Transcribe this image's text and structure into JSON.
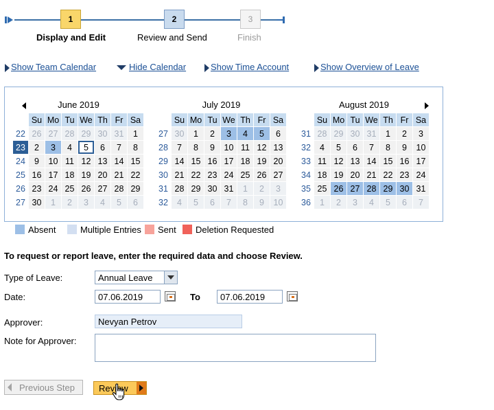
{
  "roadmap": {
    "steps": [
      {
        "number": "1",
        "label": "Display and Edit",
        "state": "current"
      },
      {
        "number": "2",
        "label": "Review and Send",
        "state": "upcoming"
      },
      {
        "number": "3",
        "label": "Finish",
        "state": "disabled"
      }
    ]
  },
  "links": {
    "show_team_calendar": "Show Team Calendar",
    "hide_calendar": "Hide Calendar",
    "show_time_account": "Show Time Account",
    "show_overview_of_leave": "Show Overview of Leave"
  },
  "calendar": {
    "weekday_headers": [
      "Su",
      "Mo",
      "Tu",
      "We",
      "Th",
      "Fr",
      "Sa"
    ],
    "months": [
      {
        "title": "June 2019",
        "weeks": [
          {
            "num": "22",
            "days": [
              [
                "26",
                "other"
              ],
              [
                "27",
                "other"
              ],
              [
                "28",
                "other"
              ],
              [
                "29",
                "other"
              ],
              [
                "30",
                "other"
              ],
              [
                "31",
                "other"
              ],
              [
                "1",
                ""
              ]
            ]
          },
          {
            "num": "23",
            "selected": true,
            "days": [
              [
                "2",
                ""
              ],
              [
                "3",
                "absent"
              ],
              [
                "4",
                ""
              ],
              [
                "5",
                "today"
              ],
              [
                "6",
                ""
              ],
              [
                "7",
                ""
              ],
              [
                "8",
                ""
              ]
            ]
          },
          {
            "num": "24",
            "days": [
              [
                "9",
                ""
              ],
              [
                "10",
                ""
              ],
              [
                "11",
                ""
              ],
              [
                "12",
                ""
              ],
              [
                "13",
                ""
              ],
              [
                "14",
                ""
              ],
              [
                "15",
                ""
              ]
            ]
          },
          {
            "num": "25",
            "days": [
              [
                "16",
                ""
              ],
              [
                "17",
                ""
              ],
              [
                "18",
                ""
              ],
              [
                "19",
                ""
              ],
              [
                "20",
                ""
              ],
              [
                "21",
                ""
              ],
              [
                "22",
                ""
              ]
            ]
          },
          {
            "num": "26",
            "days": [
              [
                "23",
                ""
              ],
              [
                "24",
                ""
              ],
              [
                "25",
                ""
              ],
              [
                "26",
                ""
              ],
              [
                "27",
                ""
              ],
              [
                "28",
                ""
              ],
              [
                "29",
                ""
              ]
            ]
          },
          {
            "num": "27",
            "days": [
              [
                "30",
                ""
              ],
              [
                "1",
                "other"
              ],
              [
                "2",
                "other"
              ],
              [
                "3",
                "other"
              ],
              [
                "4",
                "other"
              ],
              [
                "5",
                "other"
              ],
              [
                "6",
                "other"
              ]
            ]
          }
        ]
      },
      {
        "title": "July 2019",
        "weeks": [
          {
            "num": "27",
            "days": [
              [
                "30",
                "other"
              ],
              [
                "1",
                ""
              ],
              [
                "2",
                ""
              ],
              [
                "3",
                "absent"
              ],
              [
                "4",
                "absent"
              ],
              [
                "5",
                "absent"
              ],
              [
                "6",
                ""
              ]
            ]
          },
          {
            "num": "28",
            "days": [
              [
                "7",
                ""
              ],
              [
                "8",
                ""
              ],
              [
                "9",
                ""
              ],
              [
                "10",
                ""
              ],
              [
                "11",
                ""
              ],
              [
                "12",
                ""
              ],
              [
                "13",
                ""
              ]
            ]
          },
          {
            "num": "29",
            "days": [
              [
                "14",
                ""
              ],
              [
                "15",
                ""
              ],
              [
                "16",
                ""
              ],
              [
                "17",
                ""
              ],
              [
                "18",
                ""
              ],
              [
                "19",
                ""
              ],
              [
                "20",
                ""
              ]
            ]
          },
          {
            "num": "30",
            "days": [
              [
                "21",
                ""
              ],
              [
                "22",
                ""
              ],
              [
                "23",
                ""
              ],
              [
                "24",
                ""
              ],
              [
                "25",
                ""
              ],
              [
                "26",
                ""
              ],
              [
                "27",
                ""
              ]
            ]
          },
          {
            "num": "31",
            "days": [
              [
                "28",
                ""
              ],
              [
                "29",
                ""
              ],
              [
                "30",
                ""
              ],
              [
                "31",
                ""
              ],
              [
                "1",
                "other"
              ],
              [
                "2",
                "other"
              ],
              [
                "3",
                "other"
              ]
            ]
          },
          {
            "num": "32",
            "days": [
              [
                "4",
                "other"
              ],
              [
                "5",
                "other"
              ],
              [
                "6",
                "other"
              ],
              [
                "7",
                "other"
              ],
              [
                "8",
                "other"
              ],
              [
                "9",
                "other"
              ],
              [
                "10",
                "other"
              ]
            ]
          }
        ]
      },
      {
        "title": "August 2019",
        "weeks": [
          {
            "num": "31",
            "days": [
              [
                "28",
                "other"
              ],
              [
                "29",
                "other"
              ],
              [
                "30",
                "other"
              ],
              [
                "31",
                "other"
              ],
              [
                "1",
                ""
              ],
              [
                "2",
                ""
              ],
              [
                "3",
                ""
              ]
            ]
          },
          {
            "num": "32",
            "days": [
              [
                "4",
                ""
              ],
              [
                "5",
                ""
              ],
              [
                "6",
                ""
              ],
              [
                "7",
                ""
              ],
              [
                "8",
                ""
              ],
              [
                "9",
                ""
              ],
              [
                "10",
                ""
              ]
            ]
          },
          {
            "num": "33",
            "days": [
              [
                "11",
                ""
              ],
              [
                "12",
                ""
              ],
              [
                "13",
                ""
              ],
              [
                "14",
                ""
              ],
              [
                "15",
                ""
              ],
              [
                "16",
                ""
              ],
              [
                "17",
                ""
              ]
            ]
          },
          {
            "num": "34",
            "days": [
              [
                "18",
                ""
              ],
              [
                "19",
                ""
              ],
              [
                "20",
                ""
              ],
              [
                "21",
                ""
              ],
              [
                "22",
                ""
              ],
              [
                "23",
                ""
              ],
              [
                "24",
                ""
              ]
            ]
          },
          {
            "num": "35",
            "days": [
              [
                "25",
                ""
              ],
              [
                "26",
                "absent"
              ],
              [
                "27",
                "absent"
              ],
              [
                "28",
                "absent"
              ],
              [
                "29",
                "absent"
              ],
              [
                "30",
                "absent"
              ],
              [
                "31",
                ""
              ]
            ]
          },
          {
            "num": "36",
            "days": [
              [
                "1",
                "other"
              ],
              [
                "2",
                "other"
              ],
              [
                "3",
                "other"
              ],
              [
                "4",
                "other"
              ],
              [
                "5",
                "other"
              ],
              [
                "6",
                "other"
              ],
              [
                "7",
                "other"
              ]
            ]
          }
        ]
      }
    ]
  },
  "legend": {
    "items": [
      {
        "label": "Absent",
        "color": "#9dbfe6"
      },
      {
        "label": "Multiple Entries",
        "color": "#d3dff1"
      },
      {
        "label": "Sent",
        "color": "#f7a39b"
      },
      {
        "label": "Deletion Requested",
        "color": "#f0625a"
      }
    ]
  },
  "form": {
    "instruction": "To request or report leave, enter the required data and choose Review.",
    "type_of_leave_label": "Type of Leave:",
    "type_of_leave_value": "Annual Leave",
    "date_label": "Date:",
    "date_from": "07.06.2019",
    "to_label": "To",
    "date_to": "07.06.2019",
    "approver_label": "Approver:",
    "approver_value": "Nevyan Petrov",
    "note_label": "Note for Approver:",
    "note_value": ""
  },
  "buttons": {
    "previous_step": "Previous Step",
    "review": "Review"
  },
  "colors": {
    "accent_link": "#1a4f95",
    "current_step": "#f9d66a",
    "review_button": "#fbc95a",
    "selected_week": "#2c5e96"
  }
}
